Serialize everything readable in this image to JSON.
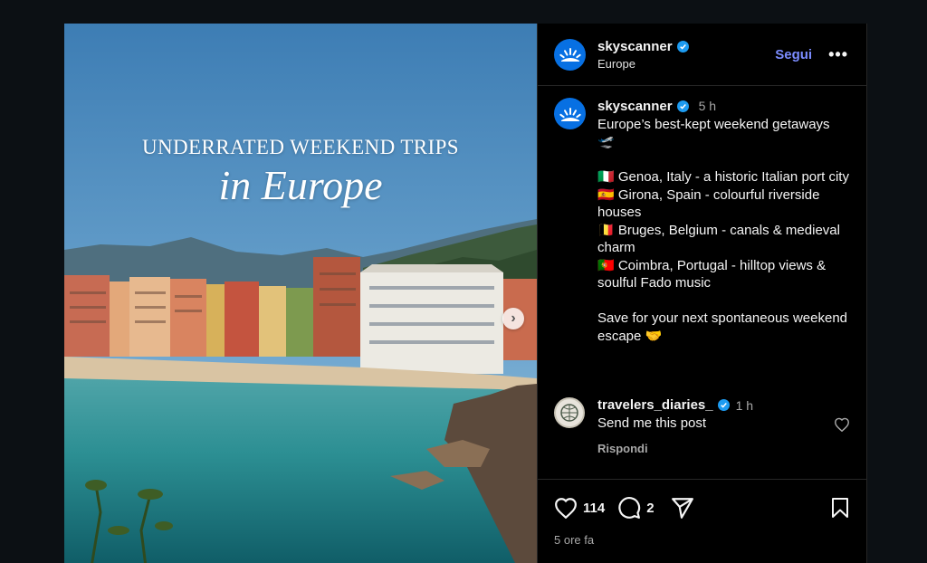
{
  "post_image": {
    "headline_line1": "UNDERRATED WEEKEND TRIPS",
    "headline_line2": "in Europe",
    "next_icon": "chevron-right-icon"
  },
  "header": {
    "username": "skyscanner",
    "verified": true,
    "location": "Europe",
    "follow_label": "Segui",
    "more_label": "•••"
  },
  "caption": {
    "username": "skyscanner",
    "time": "5 h",
    "lines": [
      "Europe’s best-kept weekend getaways",
      "🛫",
      "",
      "🇮🇹 Genoa, Italy - a historic Italian port city",
      "🇪🇸 Girona, Spain - colourful riverside houses",
      "🇧🇪 Bruges, Belgium - canals & medieval charm",
      "🇵🇹 Coimbra, Portugal - hilltop views & soulful Fado music",
      "",
      "Save for your next spontaneous weekend escape 🤝"
    ]
  },
  "comment": {
    "username": "travelers_diaries_",
    "time": "1 h",
    "text": "Send me this post",
    "reply_label": "Rispondi"
  },
  "actions": {
    "likes": "114",
    "comments": "2",
    "posted_ago": "5 ore fa"
  },
  "colors": {
    "background": "#0c1014",
    "panel": "#000000",
    "accent_link": "#7b8cff",
    "verified_blue": "#1d9bf0",
    "skyscanner_blue": "#0770e3"
  }
}
